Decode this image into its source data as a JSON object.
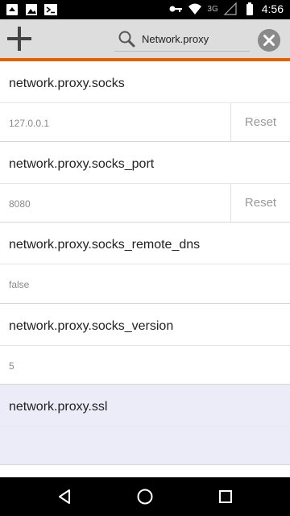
{
  "status_bar": {
    "network_label": "3G",
    "time": "4:56",
    "left_icons": [
      "notification-app-icon",
      "image-icon",
      "terminal-icon"
    ],
    "right_icons": [
      "key-icon",
      "wifi-icon",
      "signal-icon",
      "battery-icon"
    ]
  },
  "toolbar": {
    "search_value": "Network.proxy",
    "accent_color": "#e66000",
    "add_icon": "plus-icon",
    "clear_icon": "clear-icon"
  },
  "prefs": [
    {
      "name": "network.proxy.socks",
      "value": "127.0.0.1",
      "reset_label": "Reset"
    },
    {
      "name": "network.proxy.socks_port",
      "value": "8080",
      "reset_label": "Reset"
    },
    {
      "name": "network.proxy.socks_remote_dns",
      "value": "false",
      "reset_label": ""
    },
    {
      "name": "network.proxy.socks_version",
      "value": "5",
      "reset_label": ""
    },
    {
      "name": "network.proxy.ssl",
      "value": "",
      "reset_label": ""
    }
  ],
  "nav_bar": {
    "icons": [
      "back-icon",
      "home-icon",
      "recents-icon"
    ]
  }
}
